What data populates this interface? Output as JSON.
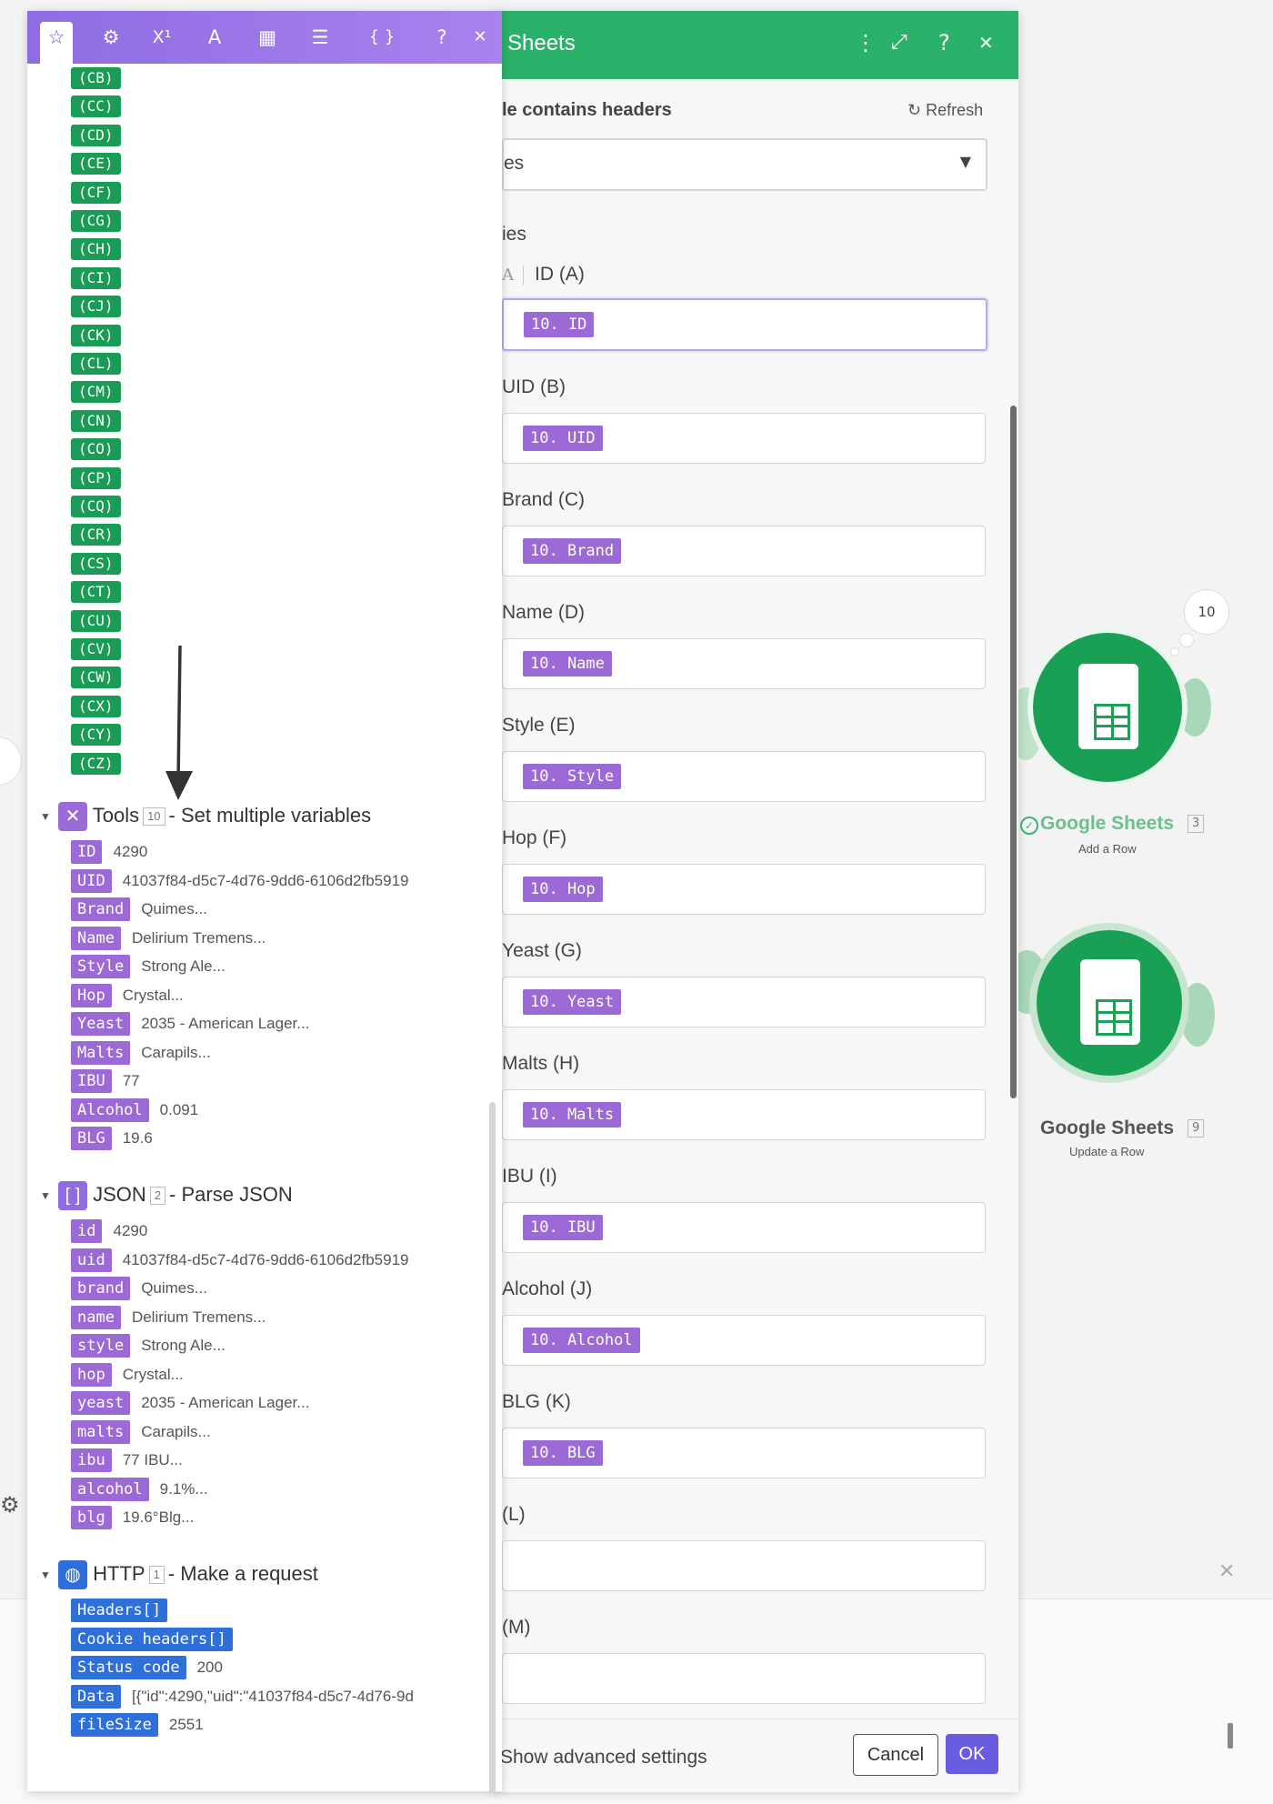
{
  "sheets_panel": {
    "title": "Sheets",
    "table_contains_headers_label": "le contains headers",
    "refresh_label": "Refresh",
    "headers_select_value": "es",
    "values_label": "ies",
    "fields": [
      {
        "label": "ID (A)",
        "value": "10. ID",
        "type_glyph": "A"
      },
      {
        "label": "UID (B)",
        "value": "10. UID"
      },
      {
        "label": "Brand (C)",
        "value": "10. Brand"
      },
      {
        "label": "Name (D)",
        "value": "10. Name"
      },
      {
        "label": "Style (E)",
        "value": "10. Style"
      },
      {
        "label": "Hop (F)",
        "value": "10. Hop"
      },
      {
        "label": "Yeast (G)",
        "value": "10. Yeast"
      },
      {
        "label": "Malts (H)",
        "value": "10. Malts"
      },
      {
        "label": "IBU (I)",
        "value": "10. IBU"
      },
      {
        "label": "Alcohol (J)",
        "value": "10. Alcohol"
      },
      {
        "label": "BLG (K)",
        "value": "10. BLG"
      },
      {
        "label": "(L)",
        "value": ""
      },
      {
        "label": "(M)",
        "value": ""
      }
    ],
    "advanced_settings_label": "Show advanced settings",
    "cancel_label": "Cancel",
    "ok_label": "OK"
  },
  "mapping_panel": {
    "toolbar_glyphs": {
      "favorites": "☆",
      "settings": "⚙",
      "math": "X¹",
      "text": "A",
      "date": "▦",
      "array": "☰",
      "json": "{ }",
      "help": "?",
      "close": "✕"
    },
    "columns": [
      "(CB)",
      "(CC)",
      "(CD)",
      "(CE)",
      "(CF)",
      "(CG)",
      "(CH)",
      "(CI)",
      "(CJ)",
      "(CK)",
      "(CL)",
      "(CM)",
      "(CN)",
      "(CO)",
      "(CP)",
      "(CQ)",
      "(CR)",
      "(CS)",
      "(CT)",
      "(CU)",
      "(CV)",
      "(CW)",
      "(CX)",
      "(CY)",
      "(CZ)"
    ],
    "tools": {
      "name": "Tools",
      "num": "10",
      "desc": "- Set multiple variables",
      "items": [
        {
          "key": "ID",
          "value": "4290"
        },
        {
          "key": "UID",
          "value": "41037f84-d5c7-4d76-9dd6-6106d2fb5919"
        },
        {
          "key": "Brand",
          "value": "Quimes..."
        },
        {
          "key": "Name",
          "value": "Delirium Tremens..."
        },
        {
          "key": "Style",
          "value": "Strong Ale..."
        },
        {
          "key": "Hop",
          "value": "Crystal..."
        },
        {
          "key": "Yeast",
          "value": "2035 - American Lager..."
        },
        {
          "key": "Malts",
          "value": "Carapils..."
        },
        {
          "key": "IBU",
          "value": "77"
        },
        {
          "key": "Alcohol",
          "value": "0.091"
        },
        {
          "key": "BLG",
          "value": "19.6"
        }
      ]
    },
    "json": {
      "name": "JSON",
      "num": "2",
      "desc": "- Parse JSON",
      "items": [
        {
          "key": "id",
          "value": "4290"
        },
        {
          "key": "uid",
          "value": "41037f84-d5c7-4d76-9dd6-6106d2fb5919"
        },
        {
          "key": "brand",
          "value": "Quimes..."
        },
        {
          "key": "name",
          "value": "Delirium Tremens..."
        },
        {
          "key": "style",
          "value": "Strong Ale..."
        },
        {
          "key": "hop",
          "value": "Crystal..."
        },
        {
          "key": "yeast",
          "value": "2035 - American Lager..."
        },
        {
          "key": "malts",
          "value": "Carapils..."
        },
        {
          "key": "ibu",
          "value": "77 IBU..."
        },
        {
          "key": "alcohol",
          "value": "9.1%..."
        },
        {
          "key": "blg",
          "value": "19.6°Blg..."
        }
      ]
    },
    "http": {
      "name": "HTTP",
      "num": "1",
      "desc": "- Make a request",
      "items": [
        {
          "key": "Headers[]",
          "value": "",
          "expandable": true
        },
        {
          "key": "Cookie headers[]",
          "value": "",
          "expandable": true
        },
        {
          "key": "Status code",
          "value": "200"
        },
        {
          "key": "Data",
          "value": "[{\"id\":4290,\"uid\":\"41037f84-d5c7-4d76-9d"
        },
        {
          "key": "fileSize",
          "value": "2551"
        }
      ]
    }
  },
  "canvas": {
    "bubble_count": "10",
    "module1": {
      "name": "Google Sheets",
      "num": "3",
      "action": "Add a Row"
    },
    "module2": {
      "name": "Google Sheets",
      "num": "9",
      "action": "Update a Row"
    }
  },
  "colors": {
    "sheets_green": "#2bb26a",
    "mapping_purple": "#9b6ad6",
    "column_green": "#1a9b56",
    "http_blue": "#2f6fd9"
  }
}
